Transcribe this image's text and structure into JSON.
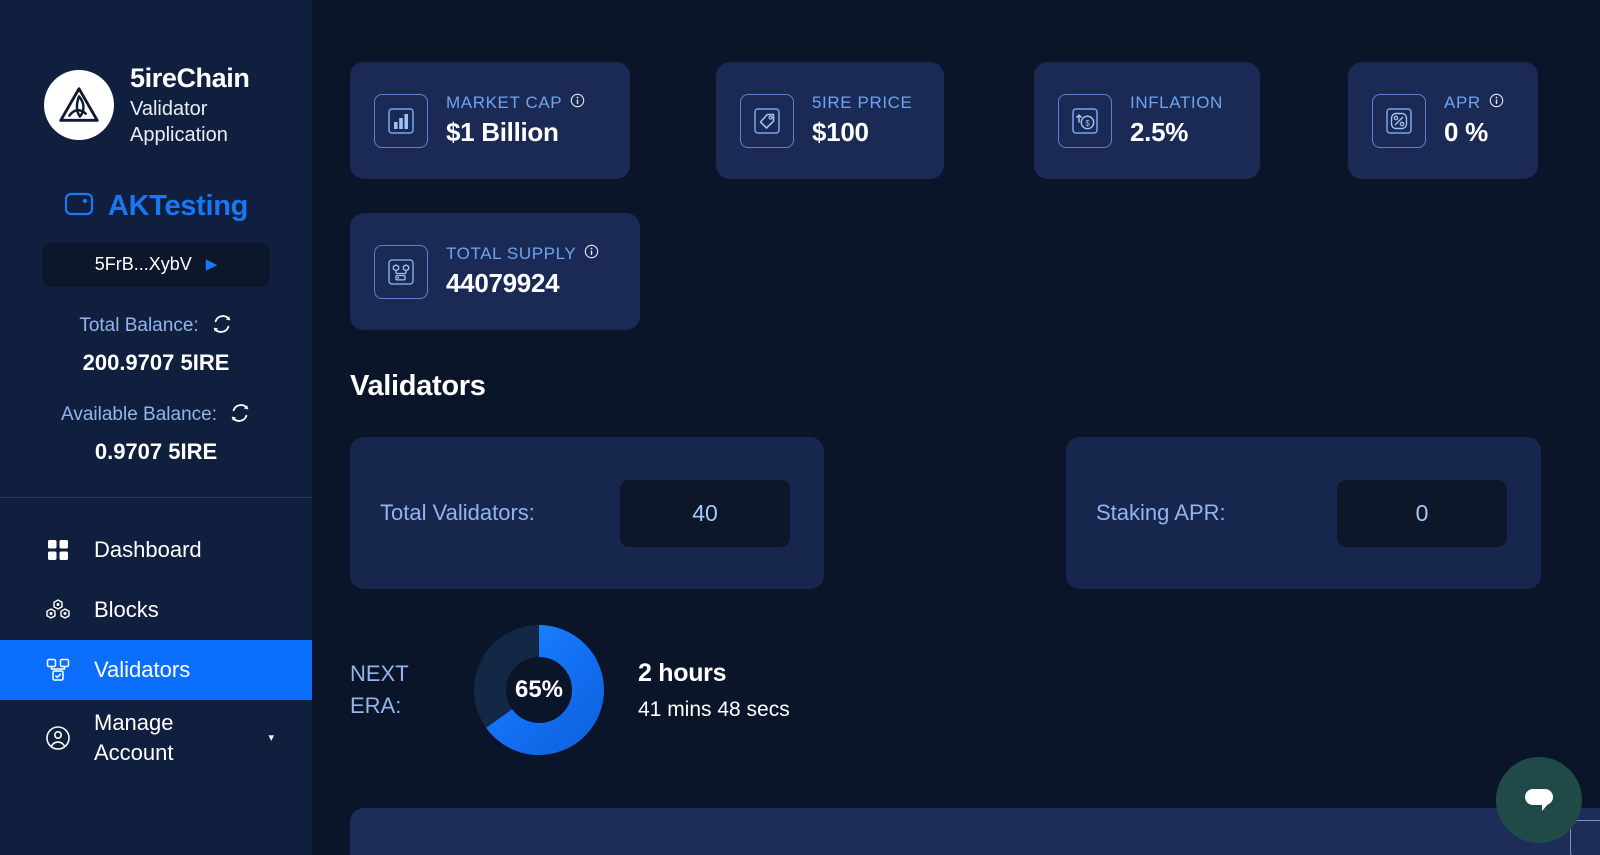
{
  "sidebar": {
    "brand": {
      "name": "5ireChain",
      "line1": "Validator",
      "line2": "Application",
      "logo_icon": "5ire-triangle-logo"
    },
    "wallet": {
      "icon": "wallet-icon",
      "name": "AKTesting",
      "address": "5FrB...XybV",
      "address_caret": "▶",
      "total_balance_label": "Total Balance:",
      "total_balance_value": "200.9707 5IRE",
      "available_balance_label": "Available Balance:",
      "available_balance_value": "0.9707 5IRE",
      "refresh_icon": "refresh-icon"
    },
    "nav": [
      {
        "label": "Dashboard",
        "icon": "grid-icon",
        "active": false
      },
      {
        "label": "Blocks",
        "icon": "blocks-icon",
        "active": false
      },
      {
        "label": "Validators",
        "icon": "validators-icon",
        "active": true
      },
      {
        "label": "Manage Account",
        "label_line1": "Manage",
        "label_line2": "Account",
        "icon": "user-circle-icon",
        "active": false,
        "caret": "▾"
      }
    ]
  },
  "stats": [
    {
      "label": "MARKET CAP",
      "value": "$1 Billion",
      "icon": "bar-chart-icon",
      "has_info": true
    },
    {
      "label": "5IRE PRICE",
      "value": "$100",
      "icon": "price-tag-icon",
      "has_info": false
    },
    {
      "label": "INFLATION",
      "value": "2.5%",
      "icon": "inflation-icon",
      "has_info": false
    },
    {
      "label": "APR",
      "value": "0 %",
      "icon": "percent-icon",
      "has_info": true
    },
    {
      "label": "TOTAL SUPPLY",
      "value": "44079924",
      "icon": "supply-network-icon",
      "has_info": true
    }
  ],
  "validators": {
    "section_title": "Validators",
    "total_validators_label": "Total Validators:",
    "total_validators_value": "40",
    "staking_apr_label": "Staking APR:",
    "staking_apr_value": "0",
    "next_era_label": "NEXT ERA:",
    "next_era_percent_text": "65%",
    "next_era_percent": 65,
    "next_era_main": "2 hours",
    "next_era_sub": "41 mins 48 secs"
  },
  "bottom": {
    "input_value": "",
    "input_placeholder": ""
  },
  "chat": {
    "icon": "chat-bubble-icon"
  },
  "colors": {
    "page_bg": "#0b1529",
    "sidebar_bg": "#111f3f",
    "card_bg": "#1a2a54",
    "panel_bg": "#17264c",
    "chip_bg": "#0d1729",
    "accent_blue": "#0b6efd",
    "label_blue": "#6ea4ef",
    "chat_teal": "#1f4a47"
  }
}
